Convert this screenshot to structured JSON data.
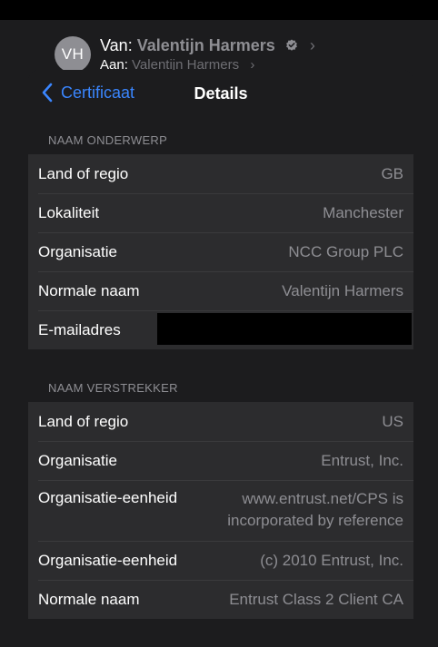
{
  "mail": {
    "avatar_initials": "VH",
    "from_label": "Van:",
    "from_name": "Valentijn Harmers",
    "to_label": "Aan:",
    "to_name": "Valentijn Harmers"
  },
  "nav": {
    "back_label": "Certificaat",
    "title": "Details"
  },
  "subject_section": {
    "header": "NAAM ONDERWERP",
    "rows": [
      {
        "label": "Land of regio",
        "value": "GB"
      },
      {
        "label": "Lokaliteit",
        "value": "Manchester"
      },
      {
        "label": "Organisatie",
        "value": "NCC Group PLC"
      },
      {
        "label": "Normale naam",
        "value": "Valentijn Harmers"
      },
      {
        "label": "E-mailadres",
        "value": ""
      }
    ]
  },
  "issuer_section": {
    "header": "NAAM VERSTREKKER",
    "rows": [
      {
        "label": "Land of regio",
        "value": "US"
      },
      {
        "label": "Organisatie",
        "value": "Entrust, Inc."
      },
      {
        "label": "Organisatie-eenheid",
        "value": "www.entrust.net/CPS is incorporated by reference"
      },
      {
        "label": "Organisatie-eenheid",
        "value": "(c) 2010 Entrust, Inc."
      },
      {
        "label": "Normale naam",
        "value": "Entrust Class 2 Client CA"
      }
    ]
  },
  "colors": {
    "accent": "#3a86ff",
    "background": "#1c1c1e",
    "cell": "#2c2c2e",
    "secondary_text": "#8e8e93"
  }
}
